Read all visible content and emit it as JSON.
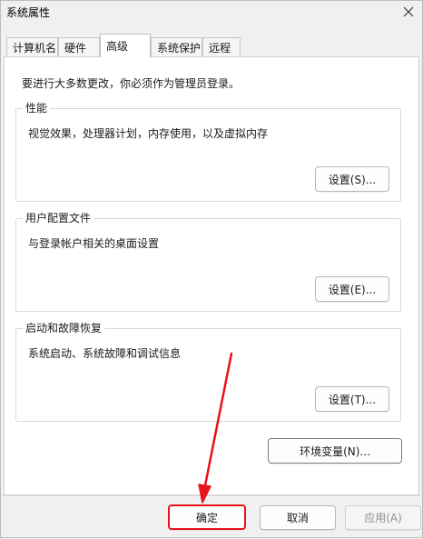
{
  "window": {
    "title": "系统属性"
  },
  "tabs": [
    {
      "label": "计算机名",
      "active": false
    },
    {
      "label": "硬件",
      "active": false
    },
    {
      "label": "高级",
      "active": true
    },
    {
      "label": "系统保护",
      "active": false
    },
    {
      "label": "远程",
      "active": false
    }
  ],
  "notice": "要进行大多数更改，你必须作为管理员登录。",
  "groups": {
    "performance": {
      "title": "性能",
      "desc": "视觉效果，处理器计划，内存使用，以及虚拟内存",
      "button": "设置(S)..."
    },
    "user_profile": {
      "title": "用户配置文件",
      "desc": "与登录帐户相关的桌面设置",
      "button": "设置(E)..."
    },
    "startup_recovery": {
      "title": "启动和故障恢复",
      "desc": "系统启动、系统故障和调试信息",
      "button": "设置(T)..."
    }
  },
  "env_button": "环境变量(N)...",
  "footer": {
    "ok": "确定",
    "cancel": "取消",
    "apply": "应用(A)"
  },
  "colors": {
    "highlight": "#e8121a"
  }
}
